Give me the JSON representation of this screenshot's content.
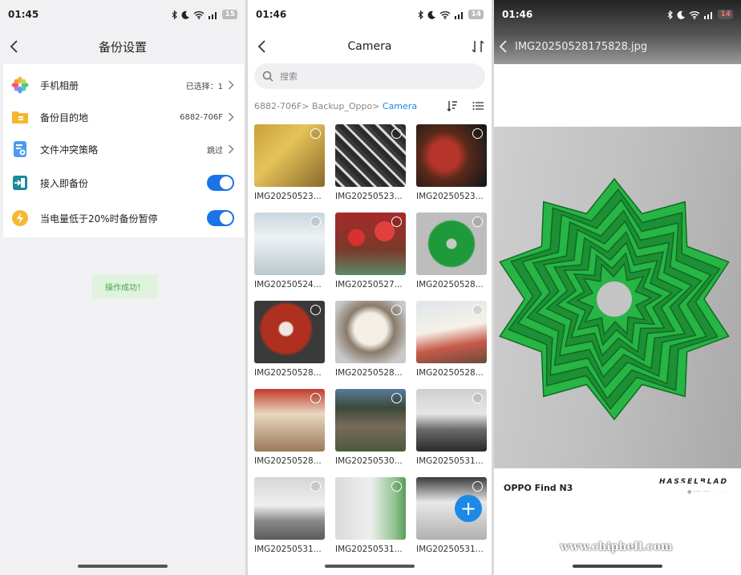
{
  "screen1": {
    "status": {
      "time": "01:45",
      "battery": "15"
    },
    "title": "备份设置",
    "rows": [
      {
        "label": "手机相册",
        "value": "已选择：1"
      },
      {
        "label": "备份目的地",
        "value": "6882-706F"
      },
      {
        "label": "文件冲突策略",
        "value": "跳过"
      },
      {
        "label": "接入即备份"
      },
      {
        "label": "当电量低于20%时备份暂停"
      }
    ],
    "toast": "操作成功！"
  },
  "screen2": {
    "status": {
      "time": "01:46",
      "battery": "14"
    },
    "title": "Camera",
    "search_placeholder": "搜索",
    "breadcrumb": {
      "path": "6882-706F> Backup_Oppo> ",
      "current": "Camera"
    },
    "files": [
      "IMG20250523...",
      "IMG20250523...",
      "IMG20250523...",
      "IMG20250524...",
      "IMG20250527...",
      "IMG20250528...",
      "IMG20250528...",
      "IMG20250528...",
      "IMG20250528...",
      "IMG20250528...",
      "IMG20250530...",
      "IMG20250531...",
      "IMG20250531...",
      "IMG20250531...",
      "IMG20250531..."
    ],
    "fab_label": "+"
  },
  "screen3": {
    "status": {
      "time": "01:46",
      "battery": "14"
    },
    "filename": "IMG20250528175828.jpg",
    "device": "OPPO Find N3",
    "brand": "HASSELBLAD",
    "watermark": "www.chiphell.com"
  },
  "colors": {
    "accent": "#1a73e8",
    "toast_bg": "#dff3df",
    "model_green": "#27b545"
  }
}
